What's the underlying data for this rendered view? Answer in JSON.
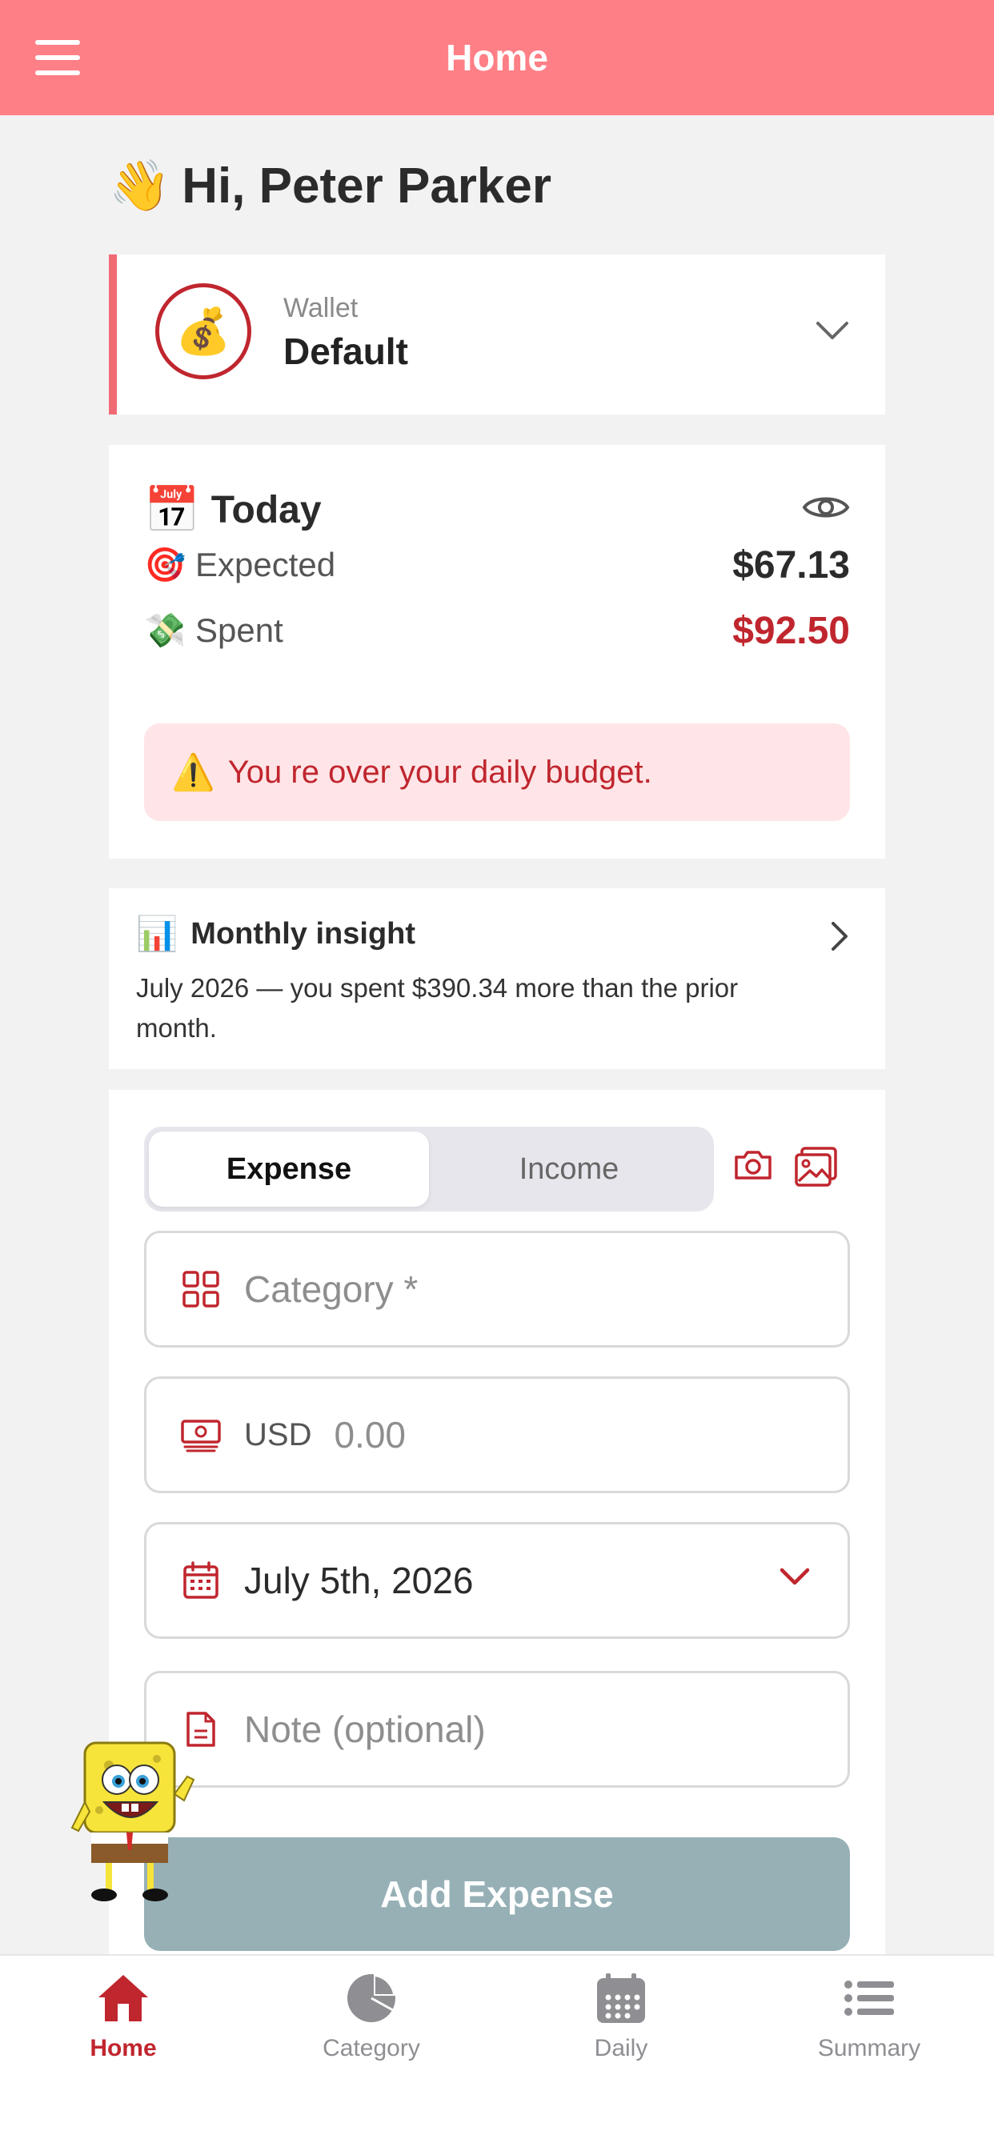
{
  "header": {
    "title": "Home"
  },
  "greeting": {
    "emoji": "👋",
    "text": "Hi, Peter Parker"
  },
  "wallet": {
    "icon": "💰",
    "label": "Wallet",
    "name": "Default"
  },
  "today": {
    "icon": "📅",
    "title": "Today",
    "expected": {
      "icon": "🎯",
      "label": "Expected",
      "value": "$67.13"
    },
    "spent": {
      "icon": "💸",
      "label": "Spent",
      "value": "$92.50"
    },
    "alert": {
      "icon": "⚠️",
      "message": "You re over your daily budget."
    }
  },
  "insight": {
    "icon": "📊",
    "title": "Monthly insight",
    "text": "July 2026 — you spent $390.34 more than the prior month."
  },
  "form": {
    "tabs": [
      {
        "label": "Expense",
        "active": true
      },
      {
        "label": "Income",
        "active": false
      }
    ],
    "category_placeholder": "Category *",
    "currency": "USD",
    "amount_placeholder": "0.00",
    "date_value": "July 5th, 2026",
    "note_placeholder": "Note (optional)",
    "submit_label": "Add Expense"
  },
  "bottom_nav": [
    {
      "label": "Home",
      "icon": "home-icon",
      "active": true
    },
    {
      "label": "Category",
      "icon": "pie-chart-icon",
      "active": false
    },
    {
      "label": "Daily",
      "icon": "calendar-icon",
      "active": false
    },
    {
      "label": "Summary",
      "icon": "list-icon",
      "active": false
    }
  ],
  "colors": {
    "header": "#ff7f86",
    "accent": "#c0262e",
    "alert_bg": "#ffe5e7",
    "button_disabled": "#96b0b6",
    "spent_value": "#c0262e"
  }
}
